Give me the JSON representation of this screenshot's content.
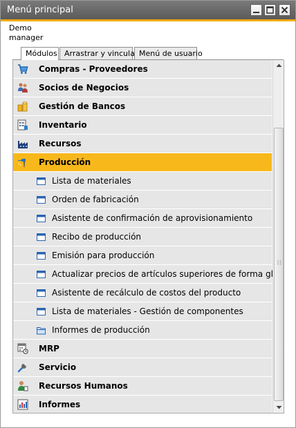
{
  "window": {
    "title": "Menú principal"
  },
  "user": {
    "line1": "Demo",
    "line2": "manager"
  },
  "tabs": [
    {
      "label": "Módulos",
      "active": true
    },
    {
      "label": "Arrastrar y vincular",
      "active": false
    },
    {
      "label": "Menú de usuario",
      "active": false
    }
  ],
  "modules": {
    "compras": "Compras - Proveedores",
    "socios": "Socios de Negocios",
    "bancos": "Gestión de Bancos",
    "inventario": "Inventario",
    "recursos": "Recursos",
    "produccion": "Producción",
    "mrp": "MRP",
    "servicio": "Servicio",
    "rrhh": "Recursos Humanos",
    "informes": "Informes"
  },
  "produccion_items": [
    "Lista de materiales",
    "Orden de fabricación",
    "Asistente de confirmación de aprovisionamiento",
    "Recibo de producción",
    "Emisión para producción",
    "Actualizar precios de artículos superiores de forma global",
    "Asistente de recálculo de costos del producto",
    "Lista de materiales - Gestión de componentes",
    "Informes de producción"
  ],
  "colors": {
    "accent": "#f0ab00",
    "selected_row": "#f7b81c",
    "titlebar": "#666666"
  }
}
